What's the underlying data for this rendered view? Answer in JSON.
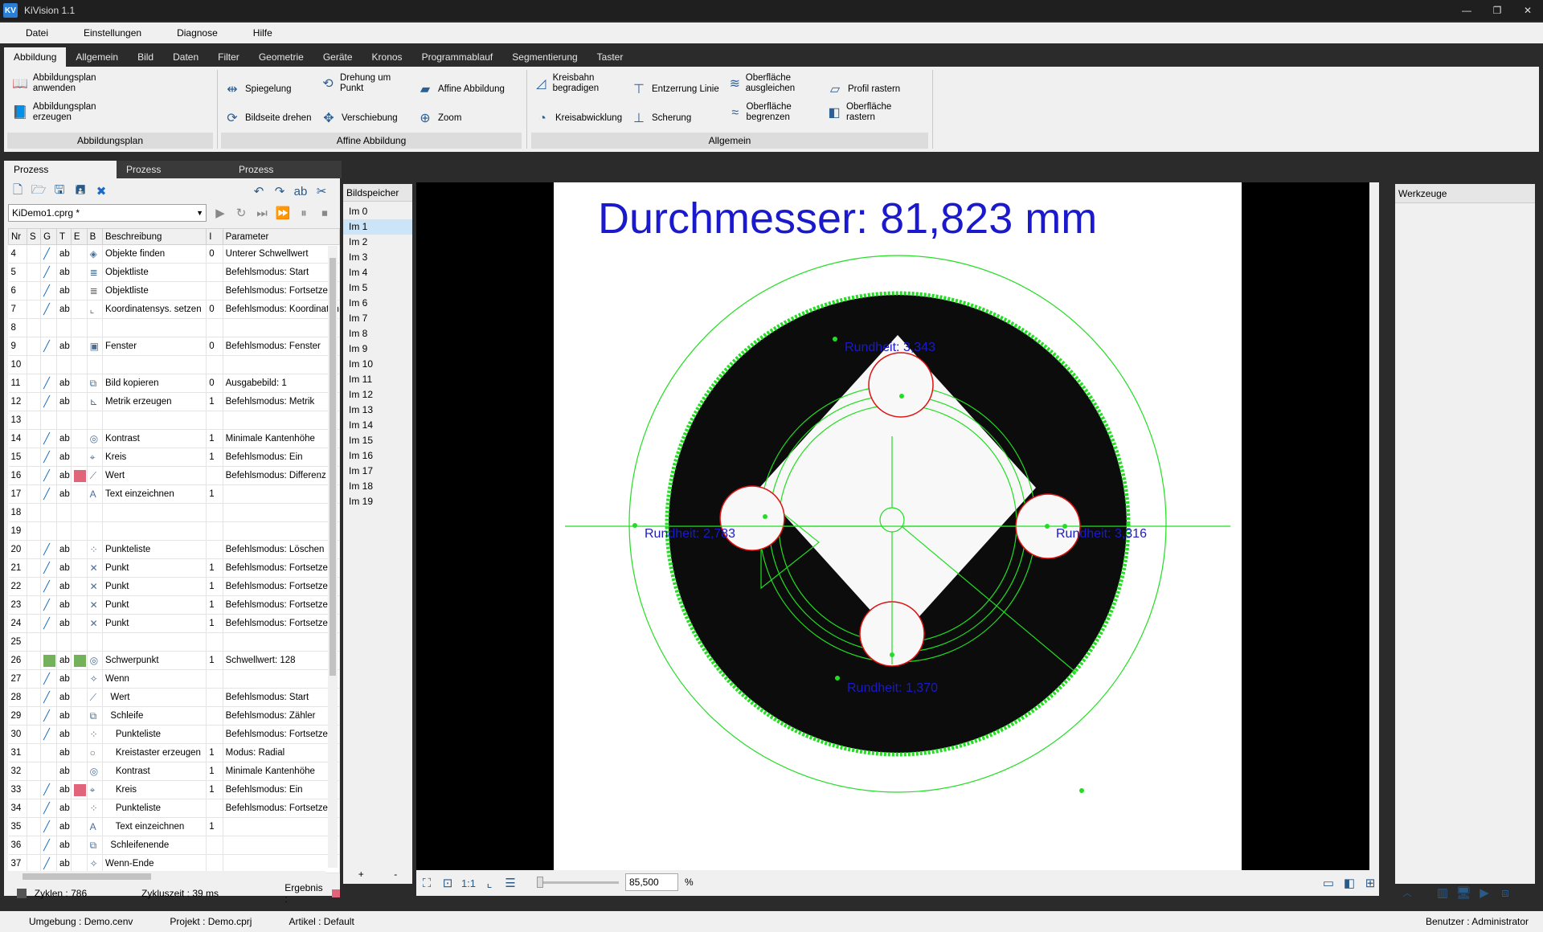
{
  "window": {
    "title": "KiVision 1.1",
    "logo": "KV"
  },
  "menu": [
    "Datei",
    "Einstellungen",
    "Diagnose",
    "Hilfe"
  ],
  "ribbon_tabs": [
    "Abbildung",
    "Allgemein",
    "Bild",
    "Daten",
    "Filter",
    "Geometrie",
    "Geräte",
    "Kronos",
    "Programmablauf",
    "Segmentierung",
    "Taster"
  ],
  "ribbon": {
    "abbildungsplan": {
      "label": "Abbildungsplan",
      "btn1": "Abbildungsplan anwenden",
      "btn2": "Abbildungsplan erzeugen"
    },
    "affine": {
      "label": "Affine Abbildung",
      "spiegelung": "Spiegelung",
      "drehung": "Drehung um Punkt",
      "affine_abb": "Affine Abbildung",
      "bildseite": "Bildseite drehen",
      "verschiebung": "Verschiebung",
      "zoom": "Zoom"
    },
    "allgemein": {
      "label": "Allgemein",
      "kreisbahn": "Kreisbahn begradigen",
      "entzerrung": "Entzerrung Linie",
      "ausgleichen": "Oberfläche ausgleichen",
      "profil": "Profil rastern",
      "kreisabw": "Kreisabwicklung",
      "scherung": "Scherung",
      "begrenzen": "Oberfläche begrenzen",
      "rastern": "Oberfläche rastern"
    }
  },
  "process_tabs": [
    "Prozess",
    "Prozess",
    "Prozess"
  ],
  "program_file": "KiDemo1.cprg *",
  "table": {
    "headers": [
      "Nr",
      "S",
      "G",
      "T",
      "E",
      "B",
      "Beschreibung",
      "I",
      "Parameter"
    ],
    "rows": [
      {
        "nr": "4",
        "g": "pen",
        "t": "ab",
        "e": "",
        "b": "◈",
        "desc": "Objekte finden",
        "i": "0",
        "param": "Unterer Schwellwert"
      },
      {
        "nr": "5",
        "g": "pen",
        "t": "ab",
        "e": "",
        "b": "≣",
        "desc": "Objektliste",
        "i": "",
        "param": "Befehlsmodus: Start"
      },
      {
        "nr": "6",
        "g": "pen",
        "t": "ab",
        "e": "",
        "b": "≣",
        "desc": "Objektliste",
        "i": "",
        "param": "Befehlsmodus: Fortsetzen"
      },
      {
        "nr": "7",
        "g": "pen",
        "t": "ab",
        "e": "",
        "b": "⌞",
        "desc": "Koordinatensys. setzen",
        "i": "0",
        "param": "Befehlsmodus: Koordinaten"
      },
      {
        "nr": "8",
        "g": "",
        "t": "",
        "e": "",
        "b": "",
        "desc": "",
        "i": "",
        "param": ""
      },
      {
        "nr": "9",
        "g": "pen",
        "t": "ab",
        "e": "",
        "b": "▣",
        "desc": "Fenster",
        "i": "0",
        "param": "Befehlsmodus: Fenster"
      },
      {
        "nr": "10",
        "g": "",
        "t": "",
        "e": "",
        "b": "",
        "desc": "",
        "i": "",
        "param": ""
      },
      {
        "nr": "11",
        "g": "pen",
        "t": "ab",
        "e": "",
        "b": "⧉",
        "desc": "Bild kopieren",
        "i": "0",
        "param": "Ausgabebild: 1"
      },
      {
        "nr": "12",
        "g": "pen",
        "t": "ab",
        "e": "",
        "b": "⊾",
        "desc": "Metrik erzeugen",
        "i": "1",
        "param": "Befehlsmodus: Metrik"
      },
      {
        "nr": "13",
        "g": "",
        "t": "",
        "e": "",
        "b": "",
        "desc": "",
        "i": "",
        "param": ""
      },
      {
        "nr": "14",
        "g": "pen",
        "t": "ab",
        "e": "",
        "b": "◎",
        "desc": "Kontrast",
        "i": "1",
        "param": "Minimale Kantenhöhe"
      },
      {
        "nr": "15",
        "g": "pen",
        "t": "ab",
        "e": "",
        "b": "⌖",
        "desc": "Kreis",
        "i": "1",
        "param": "Befehlsmodus: Ein"
      },
      {
        "nr": "16",
        "g": "pen",
        "t": "ab",
        "e": "red",
        "b": "⟋",
        "desc": "Wert",
        "i": "",
        "param": "Befehlsmodus: Differenz"
      },
      {
        "nr": "17",
        "g": "pen",
        "t": "ab",
        "e": "",
        "b": "A",
        "desc": "Text einzeichnen",
        "i": "1",
        "param": ""
      },
      {
        "nr": "18",
        "g": "",
        "t": "",
        "e": "",
        "b": "",
        "desc": "",
        "i": "",
        "param": ""
      },
      {
        "nr": "19",
        "g": "",
        "t": "",
        "e": "",
        "b": "",
        "desc": "",
        "i": "",
        "param": ""
      },
      {
        "nr": "20",
        "g": "pen",
        "t": "ab",
        "e": "",
        "b": "⁘",
        "desc": "Punkteliste",
        "i": "",
        "param": "Befehlsmodus: Löschen"
      },
      {
        "nr": "21",
        "g": "pen",
        "t": "ab",
        "e": "",
        "b": "✕",
        "desc": "Punkt",
        "i": "1",
        "param": "Befehlsmodus: Fortsetzen"
      },
      {
        "nr": "22",
        "g": "pen",
        "t": "ab",
        "e": "",
        "b": "✕",
        "desc": "Punkt",
        "i": "1",
        "param": "Befehlsmodus: Fortsetzen"
      },
      {
        "nr": "23",
        "g": "pen",
        "t": "ab",
        "e": "",
        "b": "✕",
        "desc": "Punkt",
        "i": "1",
        "param": "Befehlsmodus: Fortsetzen"
      },
      {
        "nr": "24",
        "g": "pen",
        "t": "ab",
        "e": "",
        "b": "✕",
        "desc": "Punkt",
        "i": "1",
        "param": "Befehlsmodus: Fortsetzen"
      },
      {
        "nr": "25",
        "g": "",
        "t": "",
        "e": "",
        "b": "",
        "desc": "",
        "i": "",
        "param": ""
      },
      {
        "nr": "26",
        "g": "green",
        "t": "ab",
        "e": "green",
        "b": "◎",
        "desc": "Schwerpunkt",
        "i": "1",
        "param": "Schwellwert: 128"
      },
      {
        "nr": "27",
        "g": "pen",
        "t": "ab",
        "e": "",
        "b": "✧",
        "desc": "Wenn",
        "i": "",
        "param": ""
      },
      {
        "nr": "28",
        "g": "pen",
        "t": "ab",
        "e": "",
        "b": "⟋",
        "desc": "  Wert",
        "i": "",
        "param": "Befehlsmodus: Start"
      },
      {
        "nr": "29",
        "g": "pen",
        "t": "ab",
        "e": "",
        "b": "⧉",
        "desc": "  Schleife",
        "i": "",
        "param": "Befehlsmodus: Zähler"
      },
      {
        "nr": "30",
        "g": "pen",
        "t": "ab",
        "e": "",
        "b": "⁘",
        "desc": "    Punkteliste",
        "i": "",
        "param": "Befehlsmodus: Fortsetzen"
      },
      {
        "nr": "31",
        "g": "",
        "t": "ab",
        "e": "",
        "b": "○",
        "desc": "    Kreistaster erzeugen",
        "i": "1",
        "param": "Modus: Radial"
      },
      {
        "nr": "32",
        "g": "",
        "t": "ab",
        "e": "",
        "b": "◎",
        "desc": "    Kontrast",
        "i": "1",
        "param": "Minimale Kantenhöhe"
      },
      {
        "nr": "33",
        "g": "pen",
        "t": "ab",
        "e": "red",
        "b": "⌖",
        "desc": "    Kreis",
        "i": "1",
        "param": "Befehlsmodus: Ein"
      },
      {
        "nr": "34",
        "g": "pen",
        "t": "ab",
        "e": "",
        "b": "⁘",
        "desc": "    Punkteliste",
        "i": "",
        "param": "Befehlsmodus: Fortsetzen"
      },
      {
        "nr": "35",
        "g": "pen",
        "t": "ab",
        "e": "",
        "b": "A",
        "desc": "    Text einzeichnen",
        "i": "1",
        "param": ""
      },
      {
        "nr": "36",
        "g": "pen",
        "t": "ab",
        "e": "",
        "b": "⧉",
        "desc": "  Schleifenende",
        "i": "",
        "param": ""
      },
      {
        "nr": "37",
        "g": "pen",
        "t": "ab",
        "e": "",
        "b": "✧",
        "desc": "Wenn-Ende",
        "i": "",
        "param": ""
      }
    ]
  },
  "status": {
    "zyklen": "Zyklen :  786",
    "zykluszeit": "Zykluszeit :  39  ms",
    "ergebnis": "Ergebnis :"
  },
  "bildspeicher": {
    "title": "Bildspeicher",
    "items": [
      "Im 0",
      "Im 1",
      "Im 2",
      "Im 3",
      "Im 4",
      "Im 5",
      "Im 6",
      "Im 7",
      "Im 8",
      "Im 9",
      "Im 10",
      "Im 11",
      "Im 12",
      "Im 13",
      "Im 14",
      "Im 15",
      "Im 16",
      "Im 17",
      "Im 18",
      "Im 19"
    ],
    "selected": "Im 1",
    "add": "+",
    "remove": "-"
  },
  "image": {
    "diameter_label": "Durchmesser: 81,823 mm",
    "rundheit_top": "Rundheit: 3,343",
    "rundheit_left": "Rundheit: 2,783",
    "rundheit_right": "Rundheit: 3,316",
    "rundheit_bottom": "Rundheit: 1,370"
  },
  "viewbar": {
    "zoom_value": "85,500",
    "percent": "%"
  },
  "werkzeuge": {
    "title": "Werkzeuge"
  },
  "footer": {
    "umgebung": "Umgebung :  Demo.cenv",
    "projekt": "Projekt :  Demo.cprj",
    "artikel": "Artikel :  Default",
    "benutzer": "Benutzer :  Administrator"
  },
  "colors": {
    "overlay_green": "#22dd22",
    "overlay_red": "#dd1111",
    "label_blue": "#1a1acc",
    "accent_blue": "#1f6fb8"
  }
}
